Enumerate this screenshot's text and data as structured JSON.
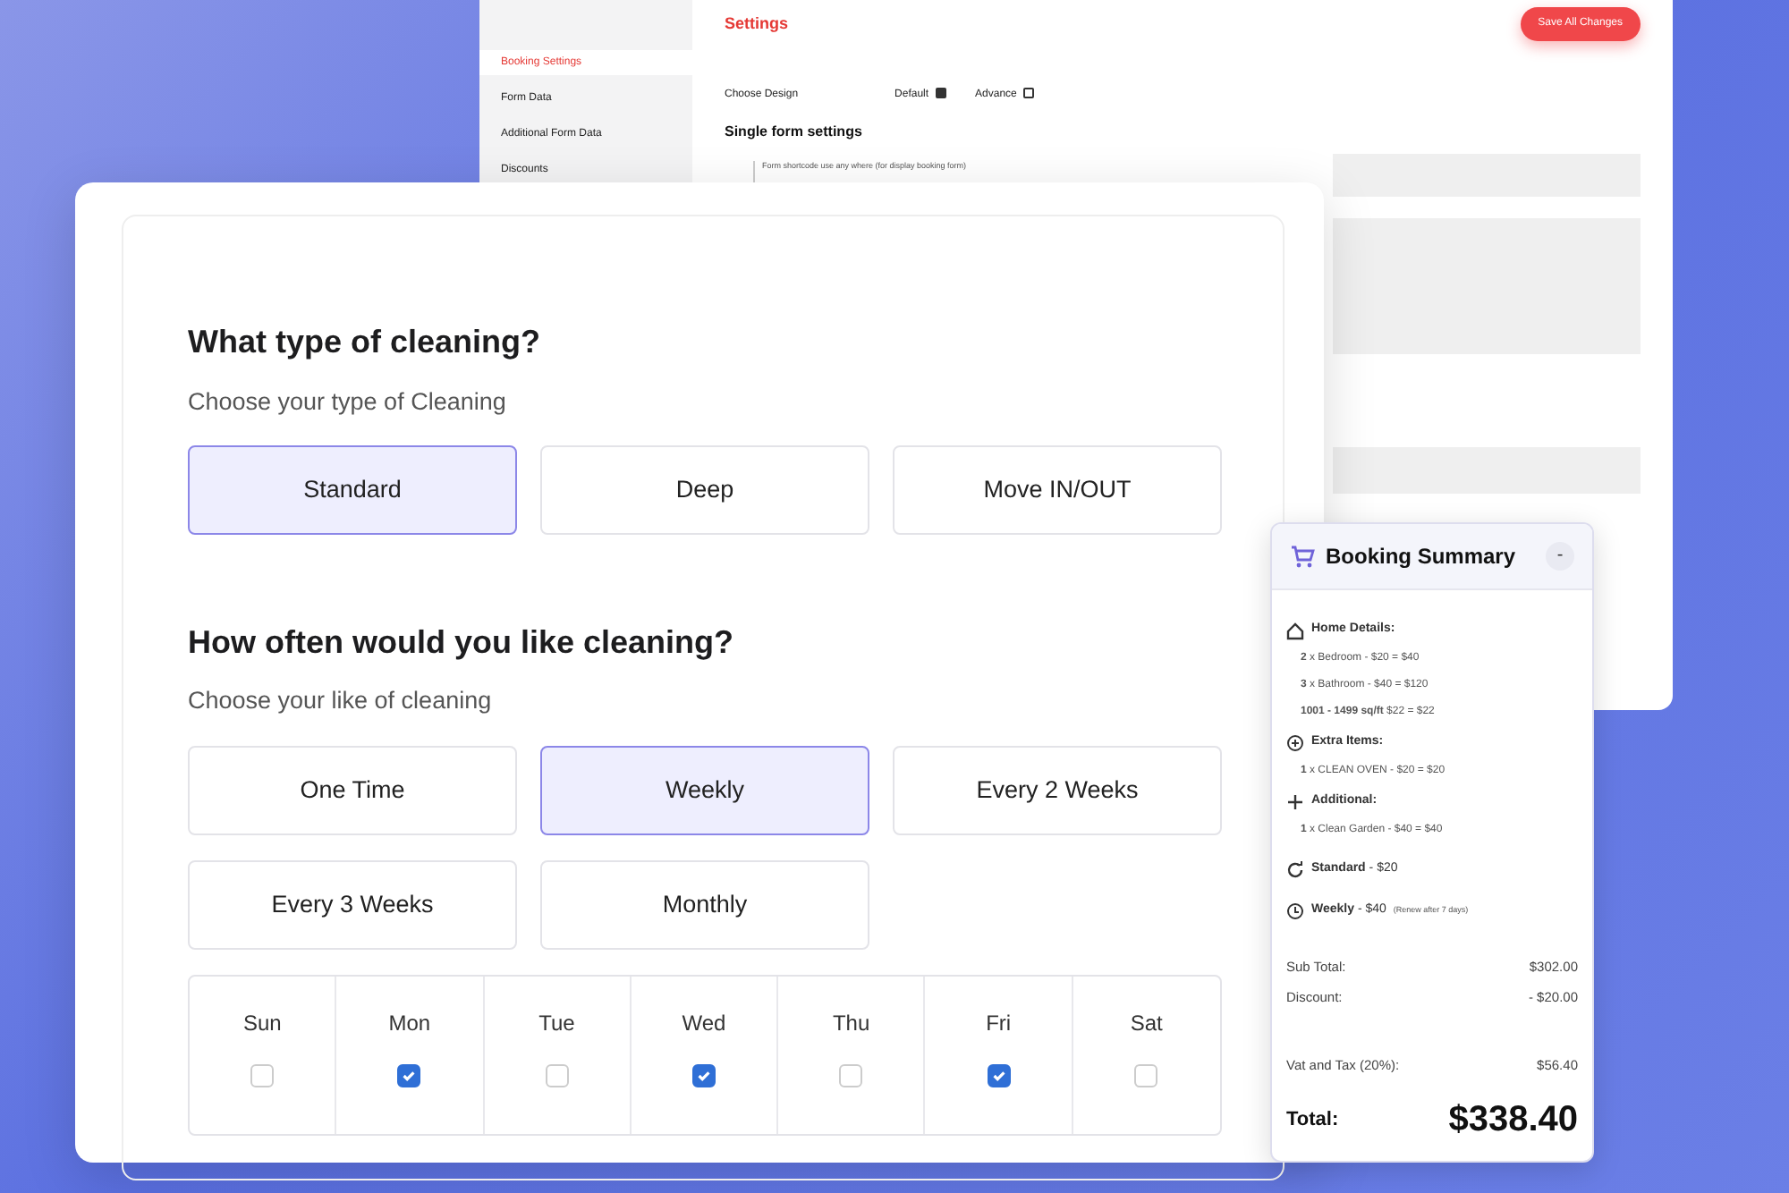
{
  "settings_window": {
    "title": "Settings",
    "save_button": "Save All Changes",
    "sidebar": [
      {
        "label": "Booking Settings",
        "selected": true
      },
      {
        "label": "Form Data",
        "selected": false
      },
      {
        "label": "Additional Form Data",
        "selected": false
      },
      {
        "label": "Discounts",
        "selected": false
      }
    ],
    "design_label": "Choose Design",
    "design_options": [
      {
        "label": "Default",
        "checked": true
      },
      {
        "label": "Advance",
        "checked": false
      }
    ],
    "section_title": "Single form settings",
    "hint": "Form shortcode use any where (for display booking form)"
  },
  "form": {
    "questions": [
      {
        "title": "What type of cleaning?",
        "subtitle": "Choose your type of Cleaning",
        "options": [
          {
            "label": "Standard",
            "selected": true
          },
          {
            "label": "Deep",
            "selected": false
          },
          {
            "label": "Move IN/OUT",
            "selected": false
          }
        ]
      },
      {
        "title": "How often would you like cleaning?",
        "subtitle": "Choose your like of cleaning",
        "options": [
          {
            "label": "One Time",
            "selected": false
          },
          {
            "label": "Weekly",
            "selected": true
          },
          {
            "label": "Every 2 Weeks",
            "selected": false
          },
          {
            "label": "Every 3 Weeks",
            "selected": false
          },
          {
            "label": "Monthly",
            "selected": false
          }
        ]
      }
    ],
    "days": [
      {
        "label": "Sun",
        "checked": false
      },
      {
        "label": "Mon",
        "checked": true
      },
      {
        "label": "Tue",
        "checked": false
      },
      {
        "label": "Wed",
        "checked": true
      },
      {
        "label": "Thu",
        "checked": false
      },
      {
        "label": "Fri",
        "checked": true
      },
      {
        "label": "Sat",
        "checked": false
      }
    ]
  },
  "summary": {
    "title": "Booking Summary",
    "collapse": "-",
    "sections": [
      {
        "kind": "home",
        "heading": "**Home Details:**",
        "lines": [
          "**2** x Bedroom - $20 = $40",
          "**3** x Bathroom - $40 = $120",
          "**1001 - 1499 sq/ft** $22 = $22"
        ]
      },
      {
        "kind": "extra",
        "heading": "**Extra Items:**",
        "lines": [
          "**1** x CLEAN OVEN - $20 = $20"
        ]
      },
      {
        "kind": "additional",
        "heading": "**Additional:**",
        "lines": [
          "**1** x Clean Garden - $40 = $40"
        ]
      },
      {
        "kind": "service",
        "heading": "**Standard** - $20"
      },
      {
        "kind": "frequency",
        "heading": "**Weekly** - $40",
        "note": "(Renew after 7 days)"
      }
    ],
    "totals": [
      {
        "label": "Sub Total:",
        "value": "$302.00"
      },
      {
        "label": "Discount:",
        "value": "- $20.00"
      }
    ],
    "tax": {
      "label": "Vat and Tax (20%):",
      "value": "$56.40"
    },
    "total": {
      "label": "Total:",
      "value": "$338.40"
    }
  }
}
